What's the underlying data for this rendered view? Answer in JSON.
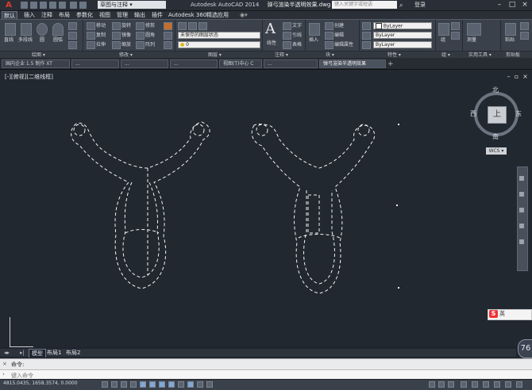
{
  "titlebar": {
    "logo": "A",
    "workspace": "草图与注释",
    "app_title": "Autodesk AutoCAD 2014",
    "doc_title": "弹弓渲染半透明效果.dwg",
    "search_placeholder": "键入关键字或短语",
    "user": "登录"
  },
  "ribbon_tabs": [
    {
      "label": "默认",
      "active": true
    },
    {
      "label": "插入"
    },
    {
      "label": "注释"
    },
    {
      "label": "布局"
    },
    {
      "label": "参数化"
    },
    {
      "label": "视图"
    },
    {
      "label": "管理"
    },
    {
      "label": "输出"
    },
    {
      "label": "插件"
    },
    {
      "label": "Autodesk 360"
    },
    {
      "label": "精选应用"
    }
  ],
  "ribbon": {
    "draw": {
      "line": "直线",
      "polyline": "多段线",
      "circle": "圆",
      "arc": "圆弧"
    },
    "modify": {
      "move": "移动",
      "rotate": "旋转",
      "trim": "修剪",
      "copy": "复制",
      "mirror": "镜像",
      "fillet": "圆角",
      "stretch": "拉伸",
      "scale": "缩放",
      "array": "阵列"
    },
    "layer_combo": "未保存的图层状态",
    "layer_value": "0",
    "text": "文字",
    "annotation": {
      "linear": "线性",
      "leader": "引线",
      "table": "表格"
    },
    "insert": "插入",
    "block": {
      "create": "创建",
      "edit": "编辑",
      "edit_attr": "编辑属性"
    },
    "properties": {
      "color": "ByLayer",
      "linetype": "ByLayer",
      "lineweight": "ByLayer"
    },
    "group": "组",
    "utilities": "测量",
    "clipboard": "粘贴",
    "view": "基点"
  },
  "panel_titles": {
    "draw": "绘图 ▾",
    "modify": "修改 ▾",
    "layers": "图层 ▾",
    "annotation": "注释 ▾",
    "block": "块 ▾",
    "properties": "特性 ▾",
    "groups": "组 ▾",
    "utilities": "实用工具 ▾",
    "clipboard": "剪贴板",
    "view": "视图 ▾"
  },
  "doc_tabs": [
    "国内企业 1.5 制作 XT",
    "...",
    "...",
    "...",
    "视图(T)中心 C",
    "...",
    "弹弓渲染半透明效果"
  ],
  "viewport_label": "[-][俯视][二维线框]",
  "viewcube": {
    "north": "北",
    "south": "南",
    "east": "东",
    "west": "西",
    "top": "上",
    "wcs": "WCS ▾"
  },
  "ime": {
    "label": "英",
    "icon": "S"
  },
  "zoom_badge": "76",
  "layout_tabs": [
    {
      "label": "模型",
      "active": true
    },
    {
      "label": "布局1"
    },
    {
      "label": "布局2"
    }
  ],
  "command": {
    "history": "命令:",
    "placeholder": "键入命令"
  },
  "status": {
    "coords": "4815.0435, 1658.3574, 0.0000"
  }
}
